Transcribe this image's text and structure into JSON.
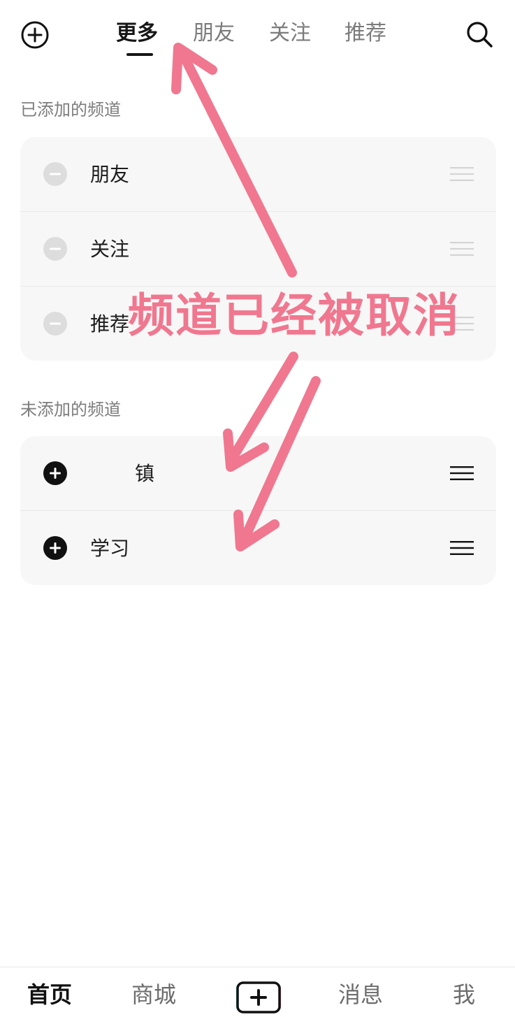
{
  "header": {
    "tabs": [
      {
        "label": "更多",
        "active": true
      },
      {
        "label": "朋友",
        "active": false
      },
      {
        "label": "关注",
        "active": false
      },
      {
        "label": "推荐",
        "active": false
      }
    ],
    "icons": [
      "add-circle-icon",
      "search-icon"
    ]
  },
  "added_section": {
    "title": "已添加的频道",
    "items": [
      {
        "label": "朋友",
        "icon": "minus-circle-icon",
        "drag_icon": "drag-handle-icon"
      },
      {
        "label": "关注",
        "icon": "minus-circle-icon",
        "drag_icon": "drag-handle-icon"
      },
      {
        "label": "推荐",
        "icon": "minus-circle-icon",
        "drag_icon": "drag-handle-icon"
      }
    ]
  },
  "unadded_section": {
    "title": "未添加的频道",
    "items": [
      {
        "label": "镇",
        "icon": "plus-circle-icon",
        "drag_icon": "drag-handle-icon"
      },
      {
        "label": "学习",
        "icon": "plus-circle-icon",
        "drag_icon": "drag-handle-icon"
      }
    ]
  },
  "annotation": {
    "text": "频道已经被取消",
    "color": "#f0778f"
  },
  "bottom_nav": {
    "home": "首页",
    "mall": "商城",
    "messages": "消息",
    "me": "我"
  },
  "colors": {
    "card": "#f7f7f7",
    "muted_icon": "#dddddd",
    "active_text": "#161616",
    "inactive_text": "#7b7b7b"
  }
}
